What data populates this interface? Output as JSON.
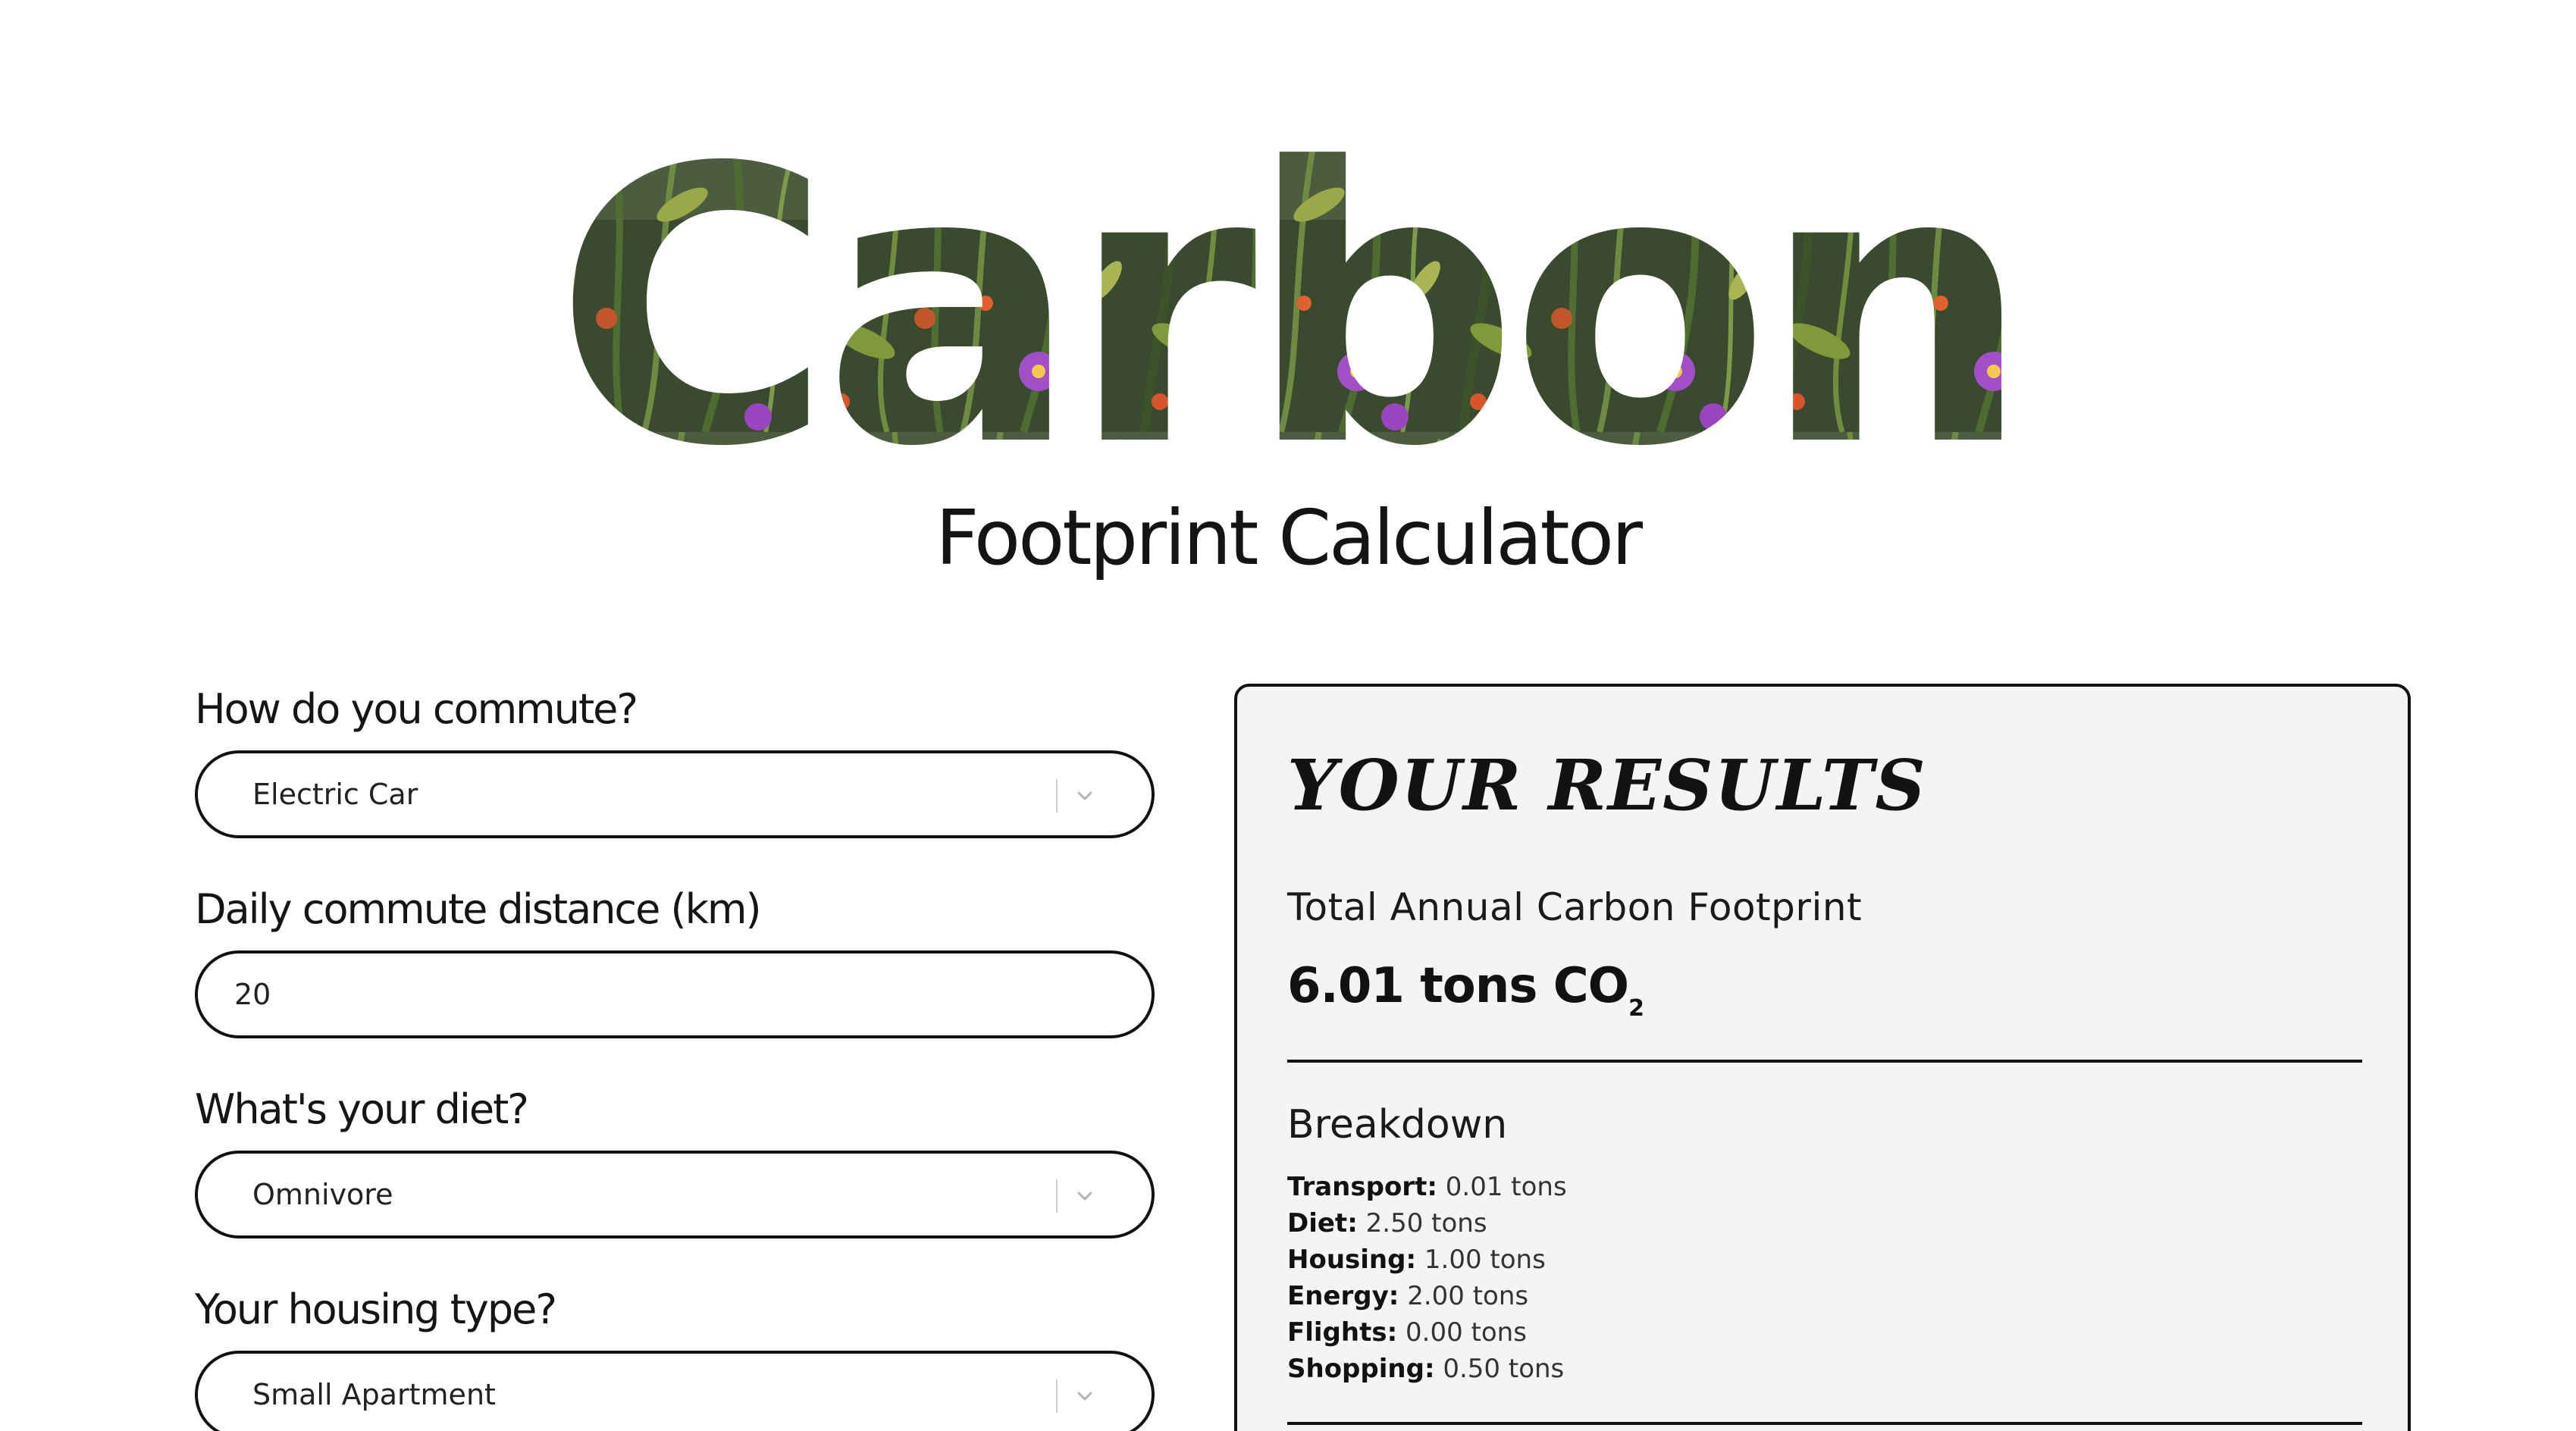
{
  "header": {
    "title": "Carbon",
    "subtitle": "Footprint Calculator"
  },
  "form": {
    "commute": {
      "label": "How do you commute?",
      "value": "Electric Car"
    },
    "distance": {
      "label": "Daily commute distance (km)",
      "value": "20"
    },
    "diet": {
      "label": "What's your diet?",
      "value": "Omnivore"
    },
    "housing": {
      "label": "Your housing type?",
      "value": "Small Apartment"
    }
  },
  "results": {
    "title": "YOUR RESULTS",
    "total_label": "Total Annual Carbon Footprint",
    "total_value": "6.01 tons CO",
    "total_unit_sub": "2",
    "breakdown_title": "Breakdown",
    "breakdown": [
      {
        "label": "Transport",
        "value": "0.01 tons"
      },
      {
        "label": "Diet",
        "value": "2.50 tons"
      },
      {
        "label": "Housing",
        "value": "1.00 tons"
      },
      {
        "label": "Energy",
        "value": "2.00 tons"
      },
      {
        "label": "Flights",
        "value": "0.00 tons"
      },
      {
        "label": "Shopping",
        "value": "0.50 tons"
      }
    ]
  },
  "colors": {
    "text": "#111111",
    "panel_bg": "#f4f4f4",
    "foliage_dark": "#2f3d26",
    "foliage_mid": "#55683f",
    "flower_purple": "#a04fc7",
    "flower_orange": "#d9532b"
  },
  "icons": {
    "select_chevron": "chevron-down-icon"
  }
}
